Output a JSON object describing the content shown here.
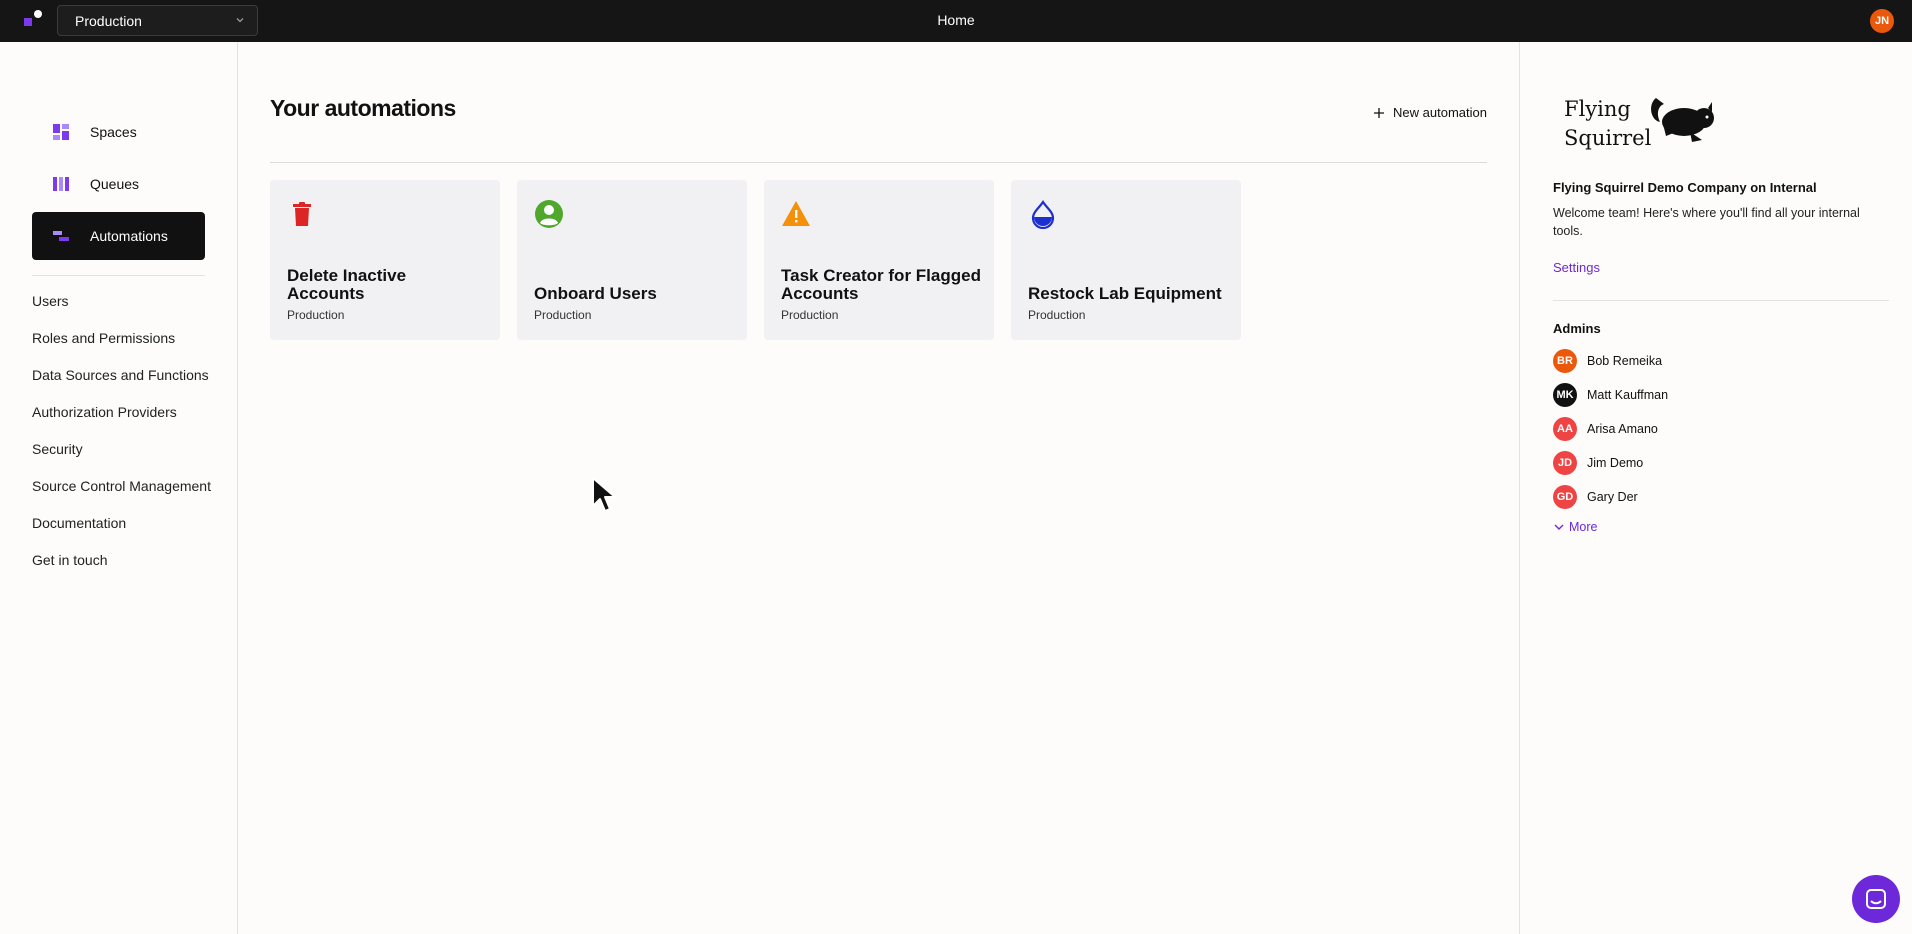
{
  "topbar": {
    "environment": "Production",
    "title": "Home",
    "user_initials": "JN"
  },
  "sidebar": {
    "main_items": [
      {
        "label": "Spaces",
        "icon": "spaces-icon"
      },
      {
        "label": "Queues",
        "icon": "queues-icon"
      },
      {
        "label": "Automations",
        "icon": "automations-icon",
        "active": true
      }
    ],
    "links": [
      "Users",
      "Roles and Permissions",
      "Data Sources and Functions",
      "Authorization Providers",
      "Security",
      "Source Control Management",
      "Documentation",
      "Get in touch"
    ]
  },
  "main": {
    "title": "Your automations",
    "new_button": "New automation",
    "cards": [
      {
        "title": "Delete Inactive Accounts",
        "subtitle": "Production",
        "icon": "trash-icon",
        "color": "#dc2626"
      },
      {
        "title": "Onboard Users",
        "subtitle": "Production",
        "icon": "user-circle-icon",
        "color": "#4fa82c"
      },
      {
        "title": "Task Creator for Flagged Accounts",
        "subtitle": "Production",
        "icon": "warning-icon",
        "color": "#f5900b"
      },
      {
        "title": "Restock Lab Equipment",
        "subtitle": "Production",
        "icon": "drop-icon",
        "color": "#1d2fd1"
      }
    ]
  },
  "right_panel": {
    "brand_line1": "Flying",
    "brand_line2": "Squirrel",
    "company": "Flying Squirrel Demo Company on Internal",
    "welcome": "Welcome team! Here's where you'll find all your internal tools.",
    "settings": "Settings",
    "admins_title": "Admins",
    "admins": [
      {
        "initials": "BR",
        "name": "Bob Remeika",
        "color": "#ea580c"
      },
      {
        "initials": "MK",
        "name": "Matt Kauffman",
        "color": "#111111"
      },
      {
        "initials": "AA",
        "name": "Arisa Amano",
        "color": "#ef4444"
      },
      {
        "initials": "JD",
        "name": "Jim Demo",
        "color": "#ef4444"
      },
      {
        "initials": "GD",
        "name": "Gary Der",
        "color": "#ef4444"
      }
    ],
    "more": "More"
  },
  "colors": {
    "accent": "#6d28d9",
    "topbar": "#151515"
  }
}
